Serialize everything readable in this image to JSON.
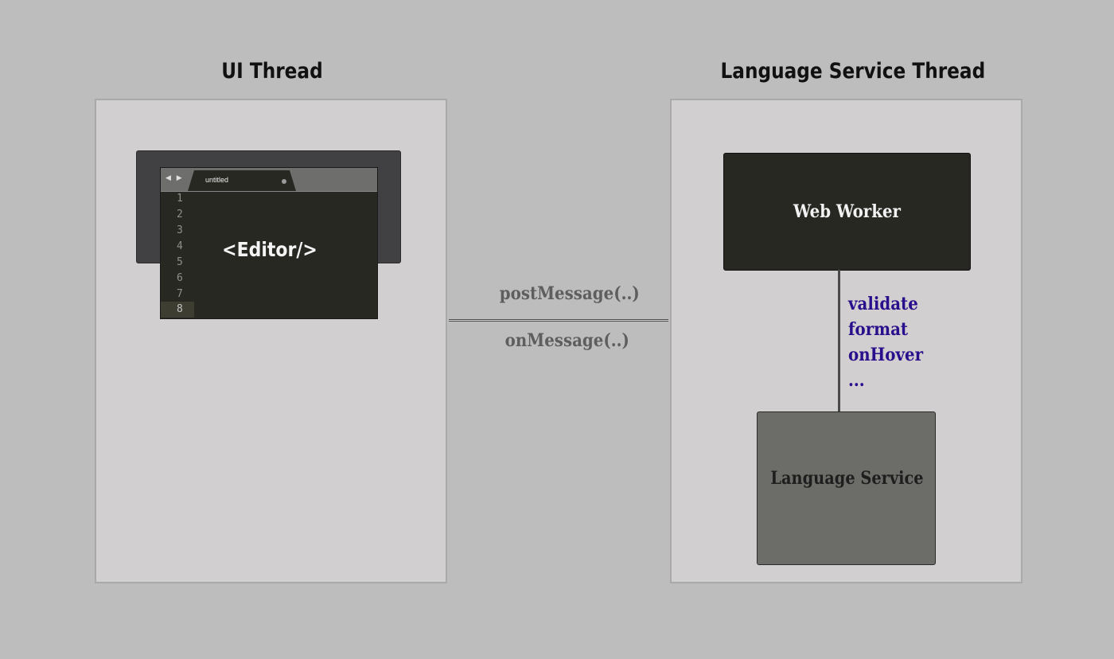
{
  "ui_thread": {
    "title": "UI Thread",
    "editor": {
      "tab_arrows": "◀ ▶",
      "tab_title": "untitled",
      "line_numbers": [
        "1",
        "2",
        "3",
        "4",
        "5",
        "6",
        "7",
        "8"
      ],
      "active_line": "8",
      "code_label": "<Editor/>"
    }
  },
  "messages": {
    "post": "postMessage(..)",
    "on": "onMessage(..)"
  },
  "language_service_thread": {
    "title": "Language Service Thread",
    "web_worker_label": "Web Worker",
    "operations": [
      "validate",
      "format",
      "onHover",
      "..."
    ],
    "language_service_label": "Language Service"
  },
  "colors": {
    "background": "#bdbdbd",
    "panel": "#d1cfd0",
    "editor_bg": "#272822",
    "operation_text": "#2a0f8c",
    "language_service_box": "#6c6d69"
  }
}
